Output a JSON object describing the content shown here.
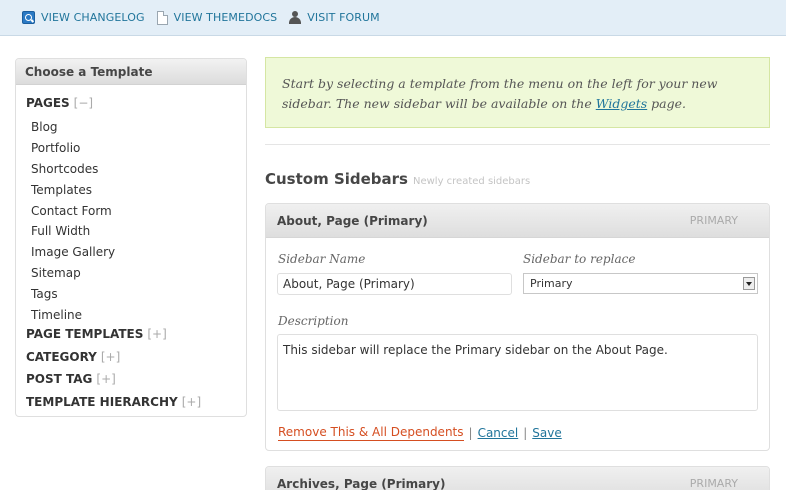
{
  "topbar": {
    "links": [
      {
        "label": "VIEW CHANGELOG",
        "icon": "search-doc-icon"
      },
      {
        "label": "VIEW THEMEDOCS",
        "icon": "document-icon"
      },
      {
        "label": "VISIT FORUM",
        "icon": "user-icon"
      }
    ]
  },
  "template_panel": {
    "title": "Choose a Template",
    "categories": [
      {
        "label": "PAGES",
        "toggle": "[−]",
        "items": [
          "Blog",
          "Portfolio",
          "Shortcodes",
          "Templates",
          "Contact Form",
          "Full Width",
          "Image Gallery",
          "Sitemap",
          "Tags",
          "Timeline"
        ]
      },
      {
        "label": "PAGE TEMPLATES",
        "toggle": "[+]"
      },
      {
        "label": "CATEGORY",
        "toggle": "[+]"
      },
      {
        "label": "POST TAG",
        "toggle": "[+]"
      },
      {
        "label": "TEMPLATE HIERARCHY",
        "toggle": "[+]"
      }
    ]
  },
  "notice": {
    "text_before": "Start by selecting a template from the menu on the left for your new sidebar. The new sidebar will be available on the ",
    "link": "Widgets",
    "text_after": " page."
  },
  "custom_sidebars": {
    "title": "Custom Sidebars",
    "subtitle": "Newly created sidebars",
    "sidebars": [
      {
        "title": "About, Page (Primary)",
        "tag": "PRIMARY",
        "name_label": "Sidebar Name",
        "name_value": "About, Page (Primary)",
        "replace_label": "Sidebar to replace",
        "replace_value": "Primary",
        "description_label": "Description",
        "description_value": "This sidebar will replace the Primary sidebar on the About Page.",
        "remove_label": "Remove This & All Dependents",
        "cancel_label": "Cancel",
        "save_label": "Save",
        "separator": "|"
      },
      {
        "title": "Archives, Page (Primary)",
        "tag": "PRIMARY"
      }
    ]
  }
}
